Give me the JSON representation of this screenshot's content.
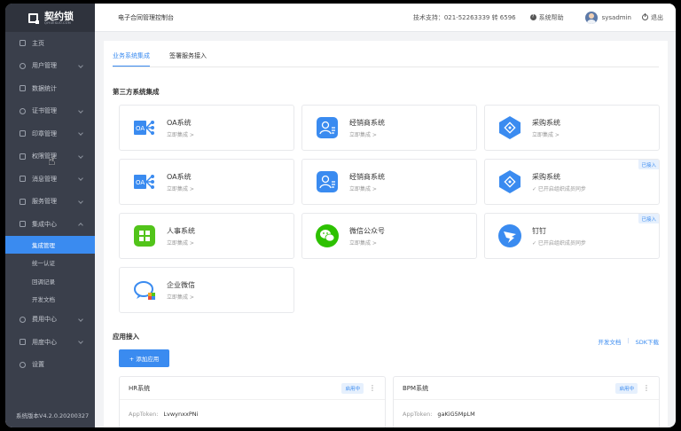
{
  "brand": {
    "logo_text": "契约锁",
    "logo_sub": "QIYUESUO.COM"
  },
  "header": {
    "title": "电子合同管理控制台",
    "support": "技术支持：021-52263339 转 6596",
    "help": "系统帮助",
    "username": "sysadmin",
    "logout": "退出"
  },
  "sidebar": {
    "items": [
      {
        "label": "主页",
        "icon": "home-icon"
      },
      {
        "label": "用户管理",
        "icon": "user-icon"
      },
      {
        "label": "数据统计",
        "icon": "star-icon"
      },
      {
        "label": "证书管理",
        "icon": "certificate-icon"
      },
      {
        "label": "印章管理",
        "icon": "seal-icon"
      },
      {
        "label": "权限管理",
        "icon": "lock-icon"
      },
      {
        "label": "消息管理",
        "icon": "message-icon"
      },
      {
        "label": "服务管理",
        "icon": "service-icon"
      },
      {
        "label": "集成中心",
        "icon": "integration-icon"
      },
      {
        "label": "费用中心",
        "icon": "fee-icon"
      },
      {
        "label": "用度中心",
        "icon": "usage-icon"
      },
      {
        "label": "设置",
        "icon": "settings-icon"
      }
    ],
    "sub_items": [
      "集成管理",
      "统一认证",
      "回调记录",
      "开发文档"
    ],
    "version": "系统版本V4.2.0.20200327"
  },
  "tabs": [
    "业务系统集成",
    "签署服务接入"
  ],
  "third_party": {
    "title": "第三方系统集成",
    "cards": [
      {
        "name": "OA系统",
        "action": "立即集成 >",
        "icon": "oa-icon",
        "color": "#3a8bf0"
      },
      {
        "name": "经销商系统",
        "action": "立即集成 >",
        "icon": "dealer-icon",
        "color": "#3a8bf0"
      },
      {
        "name": "采购系统",
        "action": "立即集成 >",
        "icon": "purchase-icon",
        "color": "#3a8bf0"
      },
      {
        "name": "OA系统",
        "action": "立即集成 >",
        "icon": "oa-icon",
        "color": "#3a8bf0"
      },
      {
        "name": "经销商系统",
        "action": "立即集成 >",
        "icon": "dealer-icon",
        "color": "#3a8bf0"
      },
      {
        "name": "采购系统",
        "action": "✓ 已开启组织成员同步",
        "icon": "purchase-icon",
        "color": "#3a8bf0",
        "badge": "已接入"
      },
      {
        "name": "人事系统",
        "action": "立即集成 >",
        "icon": "hr-icon",
        "color": "#52c41a"
      },
      {
        "name": "微信公众号",
        "action": "立即集成 >",
        "icon": "wechat-icon",
        "color": "#2dc100"
      },
      {
        "name": "钉钉",
        "action": "✓ 已开启组织成员同步",
        "icon": "dingtalk-icon",
        "color": "#3a8bf0",
        "badge": "已接入"
      },
      {
        "name": "企业微信",
        "action": "立即集成 >",
        "icon": "wecom-icon",
        "color": "#3a8bf0"
      }
    ]
  },
  "app_access": {
    "title": "应用接入",
    "links": [
      "开发文档",
      "SDK下载"
    ],
    "add_button": "+ 添加应用",
    "apps": [
      {
        "name": "HR系统",
        "status": "启用中",
        "token_label": "AppToken:",
        "token": "LvwynxxPNi"
      },
      {
        "name": "BPM系统",
        "status": "启用中",
        "token_label": "AppToken:",
        "token": "gaKiG5MpLM"
      }
    ]
  }
}
